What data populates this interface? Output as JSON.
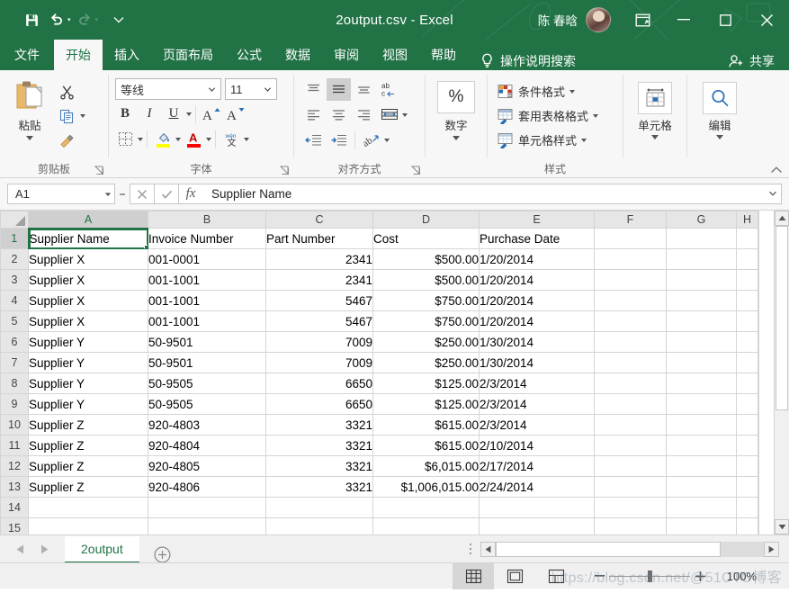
{
  "titlebar": {
    "document_title": "2output.csv  -  Excel",
    "user_name": "陈 春晗",
    "qat": [
      {
        "name": "save-icon",
        "label": "保存"
      },
      {
        "name": "undo-icon",
        "label": "撤消"
      },
      {
        "name": "redo-icon",
        "label": "恢复"
      },
      {
        "name": "customize-qat-icon",
        "label": "自定义快速访问工具栏"
      }
    ],
    "window_buttons": [
      {
        "name": "ribbon-display-options",
        "label": "功能区显示选项"
      },
      {
        "name": "minimize",
        "label": "最小化"
      },
      {
        "name": "maximize",
        "label": "最大化"
      },
      {
        "name": "close",
        "label": "关闭"
      }
    ]
  },
  "tabs": [
    {
      "label": "文件",
      "active": false
    },
    {
      "label": "开始",
      "active": true
    },
    {
      "label": "插入",
      "active": false
    },
    {
      "label": "页面布局",
      "active": false
    },
    {
      "label": "公式",
      "active": false
    },
    {
      "label": "数据",
      "active": false
    },
    {
      "label": "审阅",
      "active": false
    },
    {
      "label": "视图",
      "active": false
    },
    {
      "label": "帮助",
      "active": false
    }
  ],
  "tellme": "操作说明搜索",
  "share": "共享",
  "ribbon": {
    "clipboard": {
      "group_label": "剪贴板",
      "paste_label": "粘贴",
      "cut_label": "剪切",
      "copy_label": "复制",
      "format_painter_label": "格式刷"
    },
    "font": {
      "group_label": "字体",
      "font_name": "等线",
      "font_size": "11",
      "bold": "B",
      "italic": "I",
      "underline": "U",
      "grow_font": "A",
      "shrink_font": "A",
      "borders_label": "边框",
      "fill_color_label": "填充颜色",
      "font_color_label": "字体颜色",
      "phonetic_label": "拼音指南",
      "fill_color": "#ffff00",
      "font_color": "#ff0000"
    },
    "alignment": {
      "group_label": "对齐方式",
      "top_align": "顶端对齐",
      "middle_align": "垂直居中",
      "bottom_align": "底端对齐",
      "wrap_text": "自动换行",
      "align_left": "左对齐",
      "align_center": "居中",
      "align_right": "右对齐",
      "merge_center": "合并后居中",
      "decrease_indent": "减少缩进量",
      "increase_indent": "增加缩进量",
      "orientation": "方向"
    },
    "number": {
      "group_label": "数字",
      "percent_label": "%"
    },
    "styles": {
      "group_label": "样式",
      "items": [
        {
          "label": "条件格式",
          "icon": "conditional-formatting-icon"
        },
        {
          "label": "套用表格格式",
          "icon": "format-as-table-icon"
        },
        {
          "label": "单元格样式",
          "icon": "cell-styles-icon"
        }
      ]
    },
    "cells": {
      "label": "单元格",
      "icon": "cells-icon"
    },
    "editing": {
      "label": "编辑",
      "icon": "find-select-icon"
    }
  },
  "formula_bar": {
    "name_box": "A1",
    "cancel_label": "取消",
    "enter_label": "输入",
    "fx_label": "插入函数",
    "content": "Supplier Name"
  },
  "grid": {
    "columns": [
      "A",
      "B",
      "C",
      "D",
      "E",
      "F",
      "G",
      "H"
    ],
    "selected_cell": "A1",
    "selected_column": "A",
    "selected_row": 1,
    "rows": [
      1,
      2,
      3,
      4,
      5,
      6,
      7,
      8,
      9,
      10,
      11,
      12,
      13,
      14,
      15
    ],
    "data": [
      [
        "Supplier Name",
        "Invoice Number",
        "Part Number",
        "Cost",
        "Purchase Date",
        "",
        "",
        ""
      ],
      [
        "Supplier X",
        "001-0001",
        "2341",
        "$500.00",
        "1/20/2014",
        "",
        "",
        ""
      ],
      [
        "Supplier X",
        "001-1001",
        "2341",
        "$500.00",
        "1/20/2014",
        "",
        "",
        ""
      ],
      [
        "Supplier X",
        "001-1001",
        "5467",
        "$750.00",
        "1/20/2014",
        "",
        "",
        ""
      ],
      [
        "Supplier X",
        "001-1001",
        "5467",
        "$750.00",
        "1/20/2014",
        "",
        "",
        ""
      ],
      [
        "Supplier Y",
        "50-9501",
        "7009",
        "$250.00",
        "1/30/2014",
        "",
        "",
        ""
      ],
      [
        "Supplier Y",
        "50-9501",
        "7009",
        "$250.00",
        "1/30/2014",
        "",
        "",
        ""
      ],
      [
        "Supplier Y",
        "50-9505",
        "6650",
        "$125.00",
        "2/3/2014",
        "",
        "",
        ""
      ],
      [
        "Supplier Y",
        "50-9505",
        "6650",
        "$125.00",
        "2/3/2014",
        "",
        "",
        ""
      ],
      [
        "Supplier Z",
        "920-4803",
        "3321",
        "$615.00",
        "2/3/2014",
        "",
        "",
        ""
      ],
      [
        "Supplier Z",
        "920-4804",
        "3321",
        "$615.00",
        "2/10/2014",
        "",
        "",
        ""
      ],
      [
        "Supplier Z",
        "920-4805",
        "3321",
        "$6,015.00",
        "2/17/2014",
        "",
        "",
        ""
      ],
      [
        "Supplier Z",
        "920-4806",
        "3321",
        "$1,006,015.00",
        "2/24/2014",
        "",
        "",
        ""
      ],
      [
        "",
        "",
        "",
        "",
        "",
        "",
        "",
        ""
      ],
      [
        "",
        "",
        "",
        "",
        "",
        "",
        "",
        ""
      ]
    ],
    "numeric_columns": [
      2,
      3
    ]
  },
  "sheet_tabs": {
    "tabs": [
      {
        "label": "2output",
        "active": true
      }
    ],
    "add_sheet_label": "新建工作表",
    "prev_label": "上一张工作表",
    "next_label": "下一张工作表"
  },
  "status_bar": {
    "view_buttons": [
      {
        "name": "normal-view-icon",
        "label": "普通",
        "active": true
      },
      {
        "name": "page-layout-view-icon",
        "label": "页面布局",
        "active": false
      },
      {
        "name": "page-break-view-icon",
        "label": "分页预览",
        "active": false
      }
    ],
    "zoom_out_label": "缩小",
    "zoom_in_label": "放大",
    "zoom_value": "100%"
  },
  "watermark": "https://blog.csdn.net/@51CTO博客",
  "colors": {
    "excel_green": "#217346",
    "ribbon_bg": "#f7f7f7",
    "grid_line": "#d4d4d4",
    "header_bg": "#e6e6e6"
  }
}
